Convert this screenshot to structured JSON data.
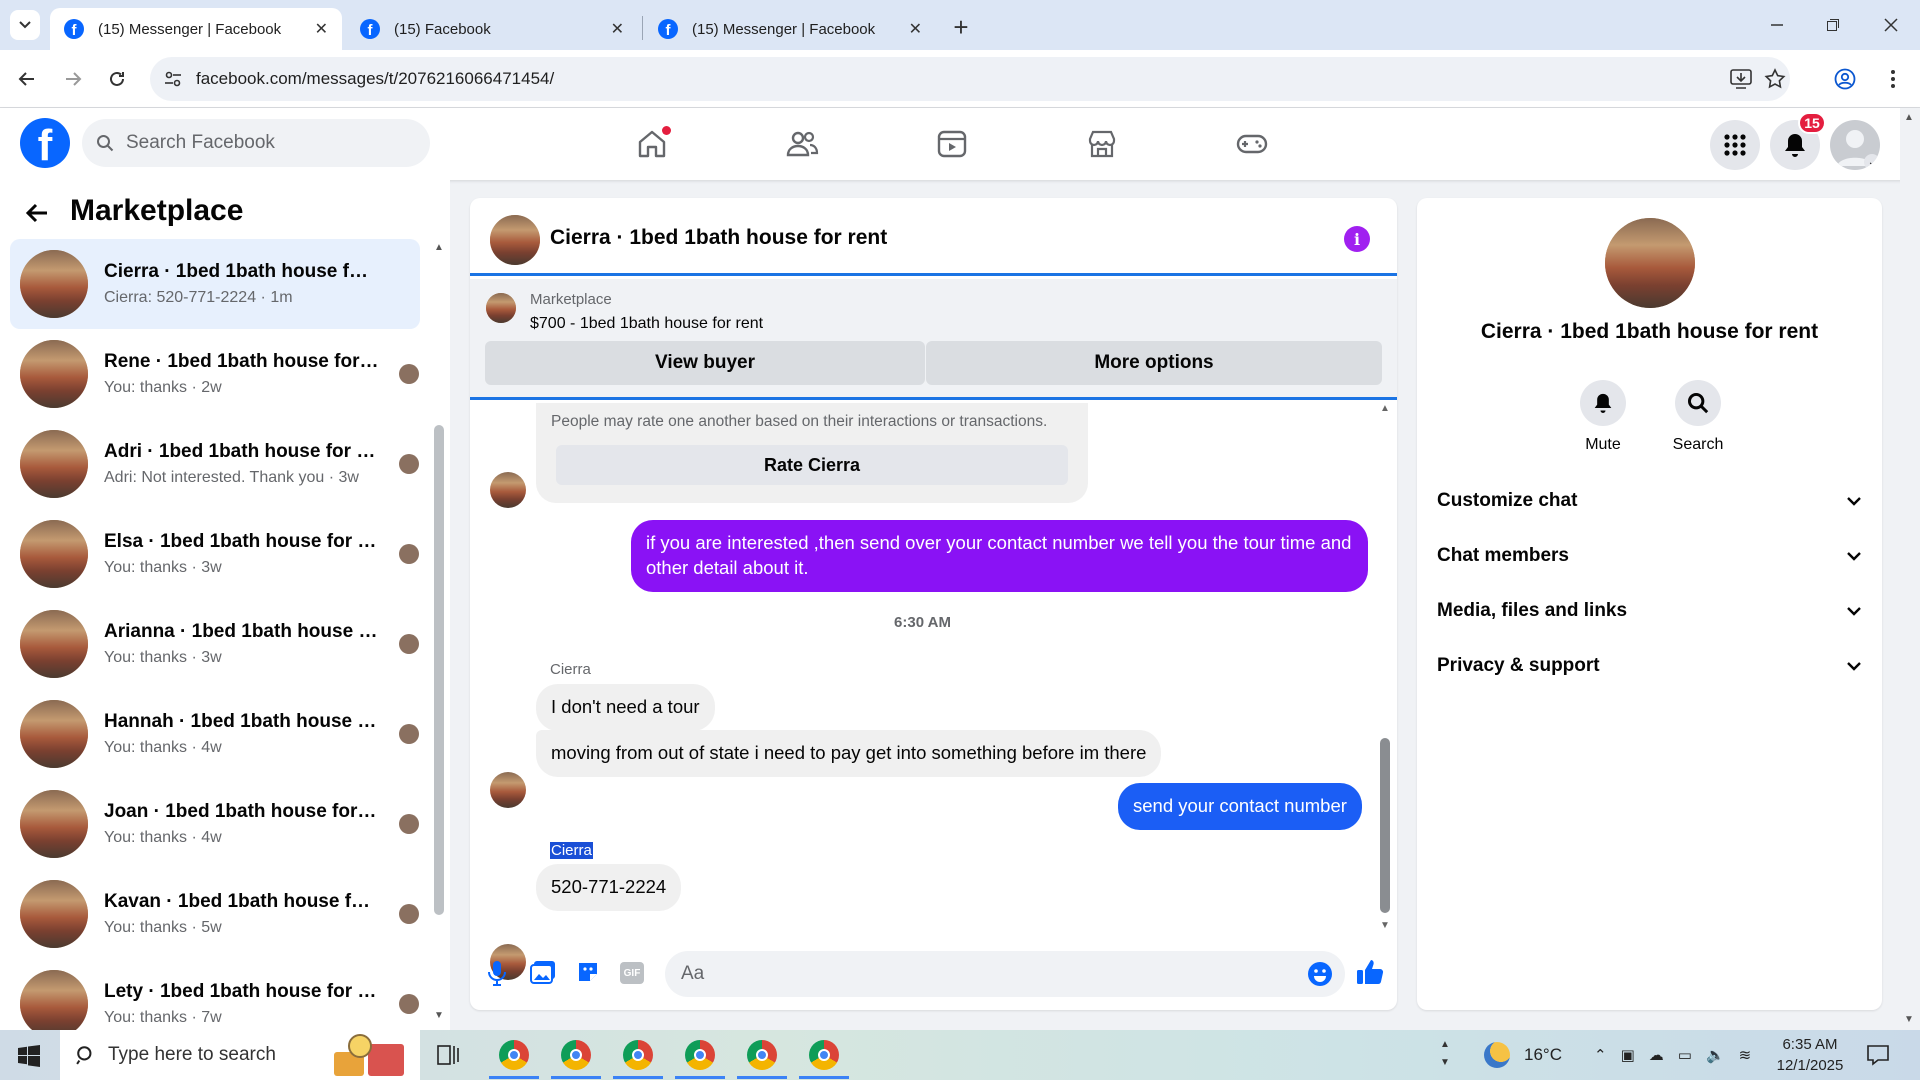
{
  "browser": {
    "tabs": [
      {
        "title": "(15) Messenger | Facebook",
        "active": true
      },
      {
        "title": "(15) Facebook",
        "active": false
      },
      {
        "title": "(15) Messenger | Facebook",
        "active": false
      }
    ],
    "url": "facebook.com/messages/t/2076216066471454/"
  },
  "fb": {
    "search_placeholder": "Search Facebook",
    "notification_count": "15"
  },
  "left": {
    "title": "Marketplace",
    "conversations": [
      {
        "name": "Cierra · 1bed 1bath house for rent",
        "snippet": "Cierra: 520-771-2224 · 1m",
        "selected": true
      },
      {
        "name": "Rene · 1bed 1bath house for r...",
        "snippet": "You: thanks · 2w"
      },
      {
        "name": "Adri · 1bed 1bath house for rent",
        "snippet": "Adri: Not interested. Thank you · 3w"
      },
      {
        "name": "Elsa · 1bed 1bath house for rent",
        "snippet": "You: thanks · 3w"
      },
      {
        "name": "Arianna · 1bed 1bath house fo...",
        "snippet": "You: thanks · 3w"
      },
      {
        "name": "Hannah · 1bed 1bath house fo...",
        "snippet": "You: thanks · 4w"
      },
      {
        "name": "Joan · 1bed 1bath house for rent",
        "snippet": "You: thanks · 4w"
      },
      {
        "name": "Kavan · 1bed 1bath house for r...",
        "snippet": "You: thanks · 5w"
      },
      {
        "name": "Lety · 1bed 1bath house for rent",
        "snippet": "You: thanks · 7w"
      }
    ]
  },
  "chat": {
    "title": "Cierra · 1bed 1bath house for rent",
    "listing_source": "Marketplace",
    "listing_title": "$700 - 1bed 1bath house for rent",
    "view_buyer": "View buyer",
    "more_options": "More options",
    "rate_note": "People may rate one another based on their interactions or transactions.",
    "rate_button": "Rate Cierra",
    "msg_out_1": "if you are interested ,then send over your contact number we tell you the tour time and other detail about it.",
    "time_sep": "6:30 AM",
    "sender_1": "Cierra",
    "msg_in_1": "I don't need a tour",
    "msg_in_2": "moving from out of state i need to pay get into something before im there",
    "msg_out_2": "send your contact number",
    "sender_2": "Cierra",
    "msg_in_3": "520-771-2224",
    "input_placeholder": "Aa",
    "colors": {
      "accent": "#0866ff",
      "bubble_purple": "#8a12f5",
      "bubble_blue": "#1b5ef5",
      "info_purple": "#a020f0"
    }
  },
  "right": {
    "title": "Cierra · 1bed 1bath house for rent",
    "mute": "Mute",
    "search": "Search",
    "rows": [
      "Customize chat",
      "Chat members",
      "Media, files and links",
      "Privacy & support"
    ]
  },
  "taskbar": {
    "search_placeholder": "Type here to search",
    "temperature": "16°C",
    "time": "6:35 AM",
    "date": "12/1/2025"
  }
}
